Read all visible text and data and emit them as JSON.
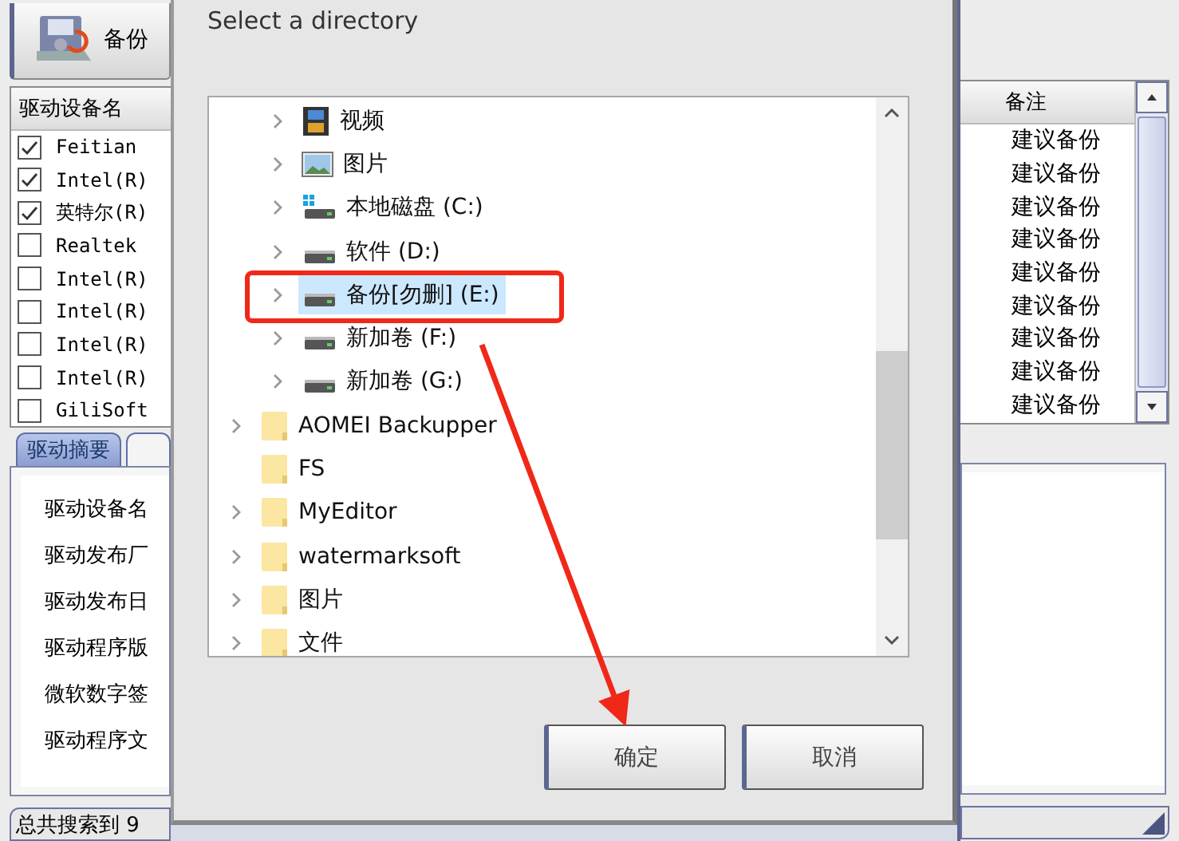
{
  "app": {
    "toolbar": {
      "backup_button": "备份"
    },
    "device_list": {
      "columns": [
        "驱动设备名",
        "备注"
      ],
      "rows": [
        {
          "name": "Feitian",
          "note": "建议备份",
          "checked": true
        },
        {
          "name": "Intel(R)",
          "note": "建议备份",
          "checked": true
        },
        {
          "name": "英特尔(R)",
          "note": "建议备份",
          "checked": true
        },
        {
          "name": "Realtek",
          "note": "建议备份",
          "checked": false
        },
        {
          "name": "Intel(R)",
          "note": "建议备份",
          "checked": false
        },
        {
          "name": "Intel(R)",
          "note": "建议备份",
          "checked": false
        },
        {
          "name": "Intel(R)",
          "note": "建议备份",
          "checked": false
        },
        {
          "name": "Intel(R)",
          "note": "建议备份",
          "checked": false
        },
        {
          "name": "GiliSoft",
          "note": "建议备份",
          "checked": false
        }
      ]
    },
    "tabs": [
      {
        "label": "驱动摘要",
        "selected": true
      }
    ],
    "summary_labels": [
      "驱动设备名",
      "驱动发布厂",
      "驱动发布日",
      "驱动程序版",
      "微软数字签",
      "驱动程序文"
    ],
    "status_bar": "总共搜索到 9"
  },
  "dialog": {
    "title": "Select a directory",
    "tree": {
      "nested_items": [
        {
          "label": "视频",
          "kind": "video",
          "expandable": true,
          "selected": false
        },
        {
          "label": "图片",
          "kind": "pictures",
          "expandable": true,
          "selected": false
        },
        {
          "label": "本地磁盘 (C:)",
          "kind": "system",
          "expandable": true,
          "selected": false
        },
        {
          "label": "软件 (D:)",
          "kind": "drive",
          "expandable": true,
          "selected": false
        },
        {
          "label": "备份[勿删] (E:)",
          "kind": "drive",
          "expandable": true,
          "selected": true
        },
        {
          "label": "新加卷 (F:)",
          "kind": "drive",
          "expandable": true,
          "selected": false
        },
        {
          "label": "新加卷 (G:)",
          "kind": "drive",
          "expandable": true,
          "selected": false
        }
      ],
      "items": [
        {
          "label": "AOMEI Backupper",
          "kind": "folder",
          "expandable": true,
          "selected": false
        },
        {
          "label": "FS",
          "kind": "folder",
          "expandable": false,
          "selected": false
        },
        {
          "label": "MyEditor",
          "kind": "folder",
          "expandable": true,
          "selected": false
        },
        {
          "label": "watermarksoft",
          "kind": "folder",
          "expandable": true,
          "selected": false
        },
        {
          "label": "图片",
          "kind": "folder",
          "expandable": true,
          "selected": false
        },
        {
          "label": "文件",
          "kind": "folder",
          "expandable": true,
          "selected": false
        }
      ]
    },
    "buttons": [
      "确定",
      "取消"
    ]
  }
}
